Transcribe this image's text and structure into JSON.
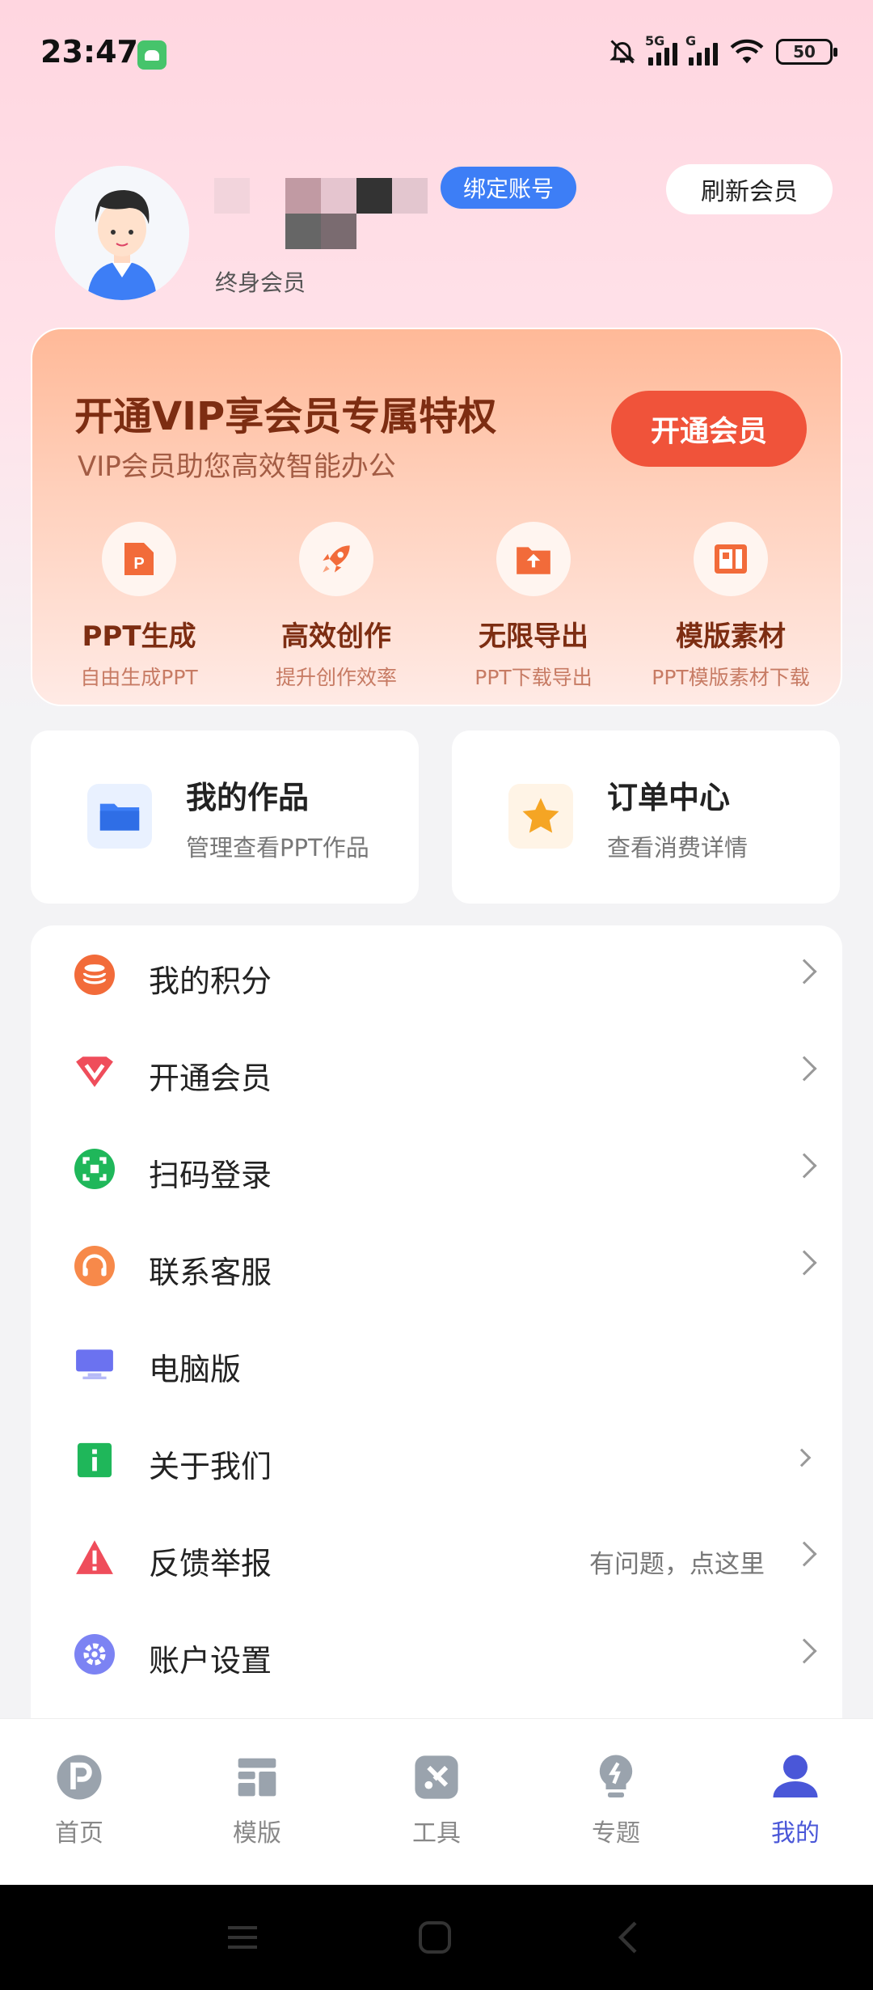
{
  "status_bar": {
    "time": "23:47",
    "network_5g": "5G",
    "network_g": "G",
    "battery": "50"
  },
  "profile": {
    "bind_account_label": "绑定账号",
    "refresh_label": "刷新会员",
    "member_type": "终身会员"
  },
  "vip": {
    "title": "开通VIP享会员专属特权",
    "subtitle": "VIP会员助您高效智能办公",
    "button_label": "开通会员",
    "features": [
      {
        "title": "PPT生成",
        "subtitle": "自由生成PPT",
        "icon": "ppt-icon"
      },
      {
        "title": "高效创作",
        "subtitle": "提升创作效率",
        "icon": "rocket-icon"
      },
      {
        "title": "无限导出",
        "subtitle": "PPT下载导出",
        "icon": "export-icon"
      },
      {
        "title": "模版素材",
        "subtitle": "PPT模版素材下载",
        "icon": "template-icon"
      }
    ]
  },
  "quick_cards": [
    {
      "title": "我的作品",
      "subtitle": "管理查看PPT作品",
      "icon": "folder-icon"
    },
    {
      "title": "订单中心",
      "subtitle": "查看消费详情",
      "icon": "star-icon"
    }
  ],
  "menu": [
    {
      "label": "我的积分",
      "icon": "coins-icon"
    },
    {
      "label": "开通会员",
      "icon": "vip-diamond-icon"
    },
    {
      "label": "扫码登录",
      "icon": "scan-icon"
    },
    {
      "label": "联系客服",
      "icon": "headset-icon"
    },
    {
      "label": "电脑版",
      "icon": "desktop-icon"
    },
    {
      "label": "关于我们",
      "icon": "info-icon"
    },
    {
      "label": "反馈举报",
      "icon": "warning-icon",
      "hint": "有问题，点这里"
    },
    {
      "label": "账户设置",
      "icon": "settings-icon"
    }
  ],
  "bottom_nav": [
    {
      "label": "首页",
      "icon": "home-p-icon"
    },
    {
      "label": "模版",
      "icon": "template-grid-icon"
    },
    {
      "label": "工具",
      "icon": "tools-icon"
    },
    {
      "label": "专题",
      "icon": "bulb-icon"
    },
    {
      "label": "我的",
      "icon": "user-icon",
      "active": true
    }
  ],
  "colors": {
    "accent": "#4a57d8",
    "vip_button": "#f0533a",
    "bind_badge": "#3d7ef6"
  }
}
